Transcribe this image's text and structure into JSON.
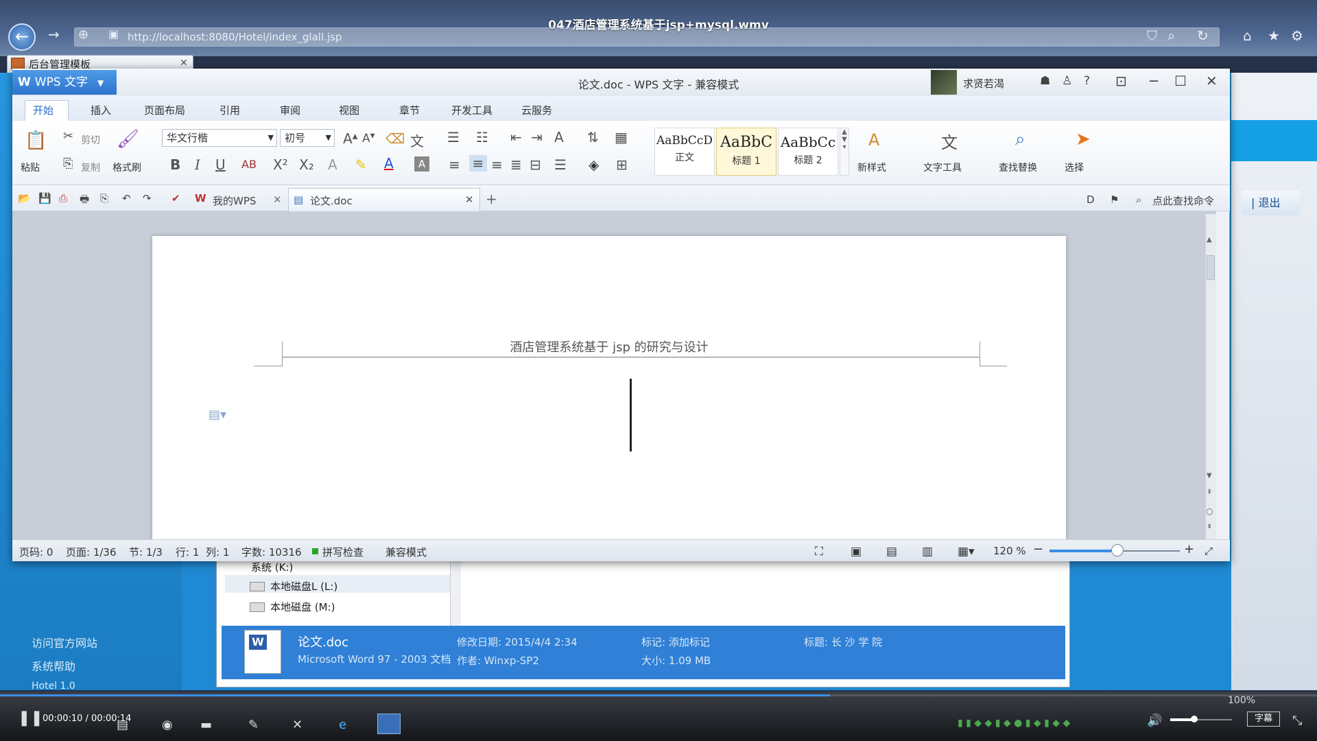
{
  "video": {
    "title": "047酒店管理系统基于jsp+mysql.wmv",
    "time": "00:00:10 / 00:00:14",
    "zoom": "100%",
    "subtitle_label": "字幕",
    "progress": 0.63
  },
  "browser": {
    "address": "http://localhost:8080/Hotel/index_glall.jsp",
    "tab_label": "后台管理模板"
  },
  "bg_app": {
    "left_links": [
      "访问官方网站",
      "系统帮助",
      "Hotel 1.0"
    ],
    "exit_label": "| 退出"
  },
  "explorer": {
    "tree": [
      "系统 (K:)",
      "本地磁盘L (L:)",
      "本地磁盘 (M:)"
    ],
    "file_name": "论文.doc",
    "file_type": "Microsoft Word 97 - 2003 文档",
    "modified": "修改日期: 2015/4/4 2:34",
    "author": "作者: Winxp-SP2",
    "tag": "标记: 添加标记",
    "size": "大小: 1.09 MB",
    "heading": "标题: 长 沙 学 院"
  },
  "wps": {
    "app_button": "WPS 文字",
    "doc_title": "论文.doc - WPS 文字 - 兼容模式",
    "user_name": "求贤若渴",
    "tabs": [
      "开始",
      "插入",
      "页面布局",
      "引用",
      "审阅",
      "视图",
      "章节",
      "开发工具",
      "云服务"
    ],
    "ribbon": {
      "paste": "粘贴",
      "cut": "剪切",
      "copy": "复制",
      "format_painter": "格式刷",
      "font_name": "华文行楷",
      "font_size": "初号",
      "styles": [
        {
          "sample": "AaBbCcD",
          "name": "正文"
        },
        {
          "sample": "AaBbC",
          "name": "标题 1"
        },
        {
          "sample": "AaBbCc",
          "name": "标题 2"
        }
      ],
      "new_style": "新样式",
      "text_tools": "文字工具",
      "find_replace": "查找替换",
      "select": "选择"
    },
    "quickbar": {
      "my_wps": "我的WPS",
      "doc_tab": "论文.doc",
      "search": "点此查找命令"
    },
    "document": {
      "header": "酒店管理系统基于 jsp 的研究与设计"
    },
    "status": {
      "page_code": "页码: 0",
      "pages": "页面: 1/36",
      "section": "节: 1/3",
      "line": "行: 1",
      "col": "列: 1",
      "words": "字数: 10316",
      "spell": "拼写检查",
      "compat": "兼容模式",
      "zoom": "120 %"
    }
  }
}
